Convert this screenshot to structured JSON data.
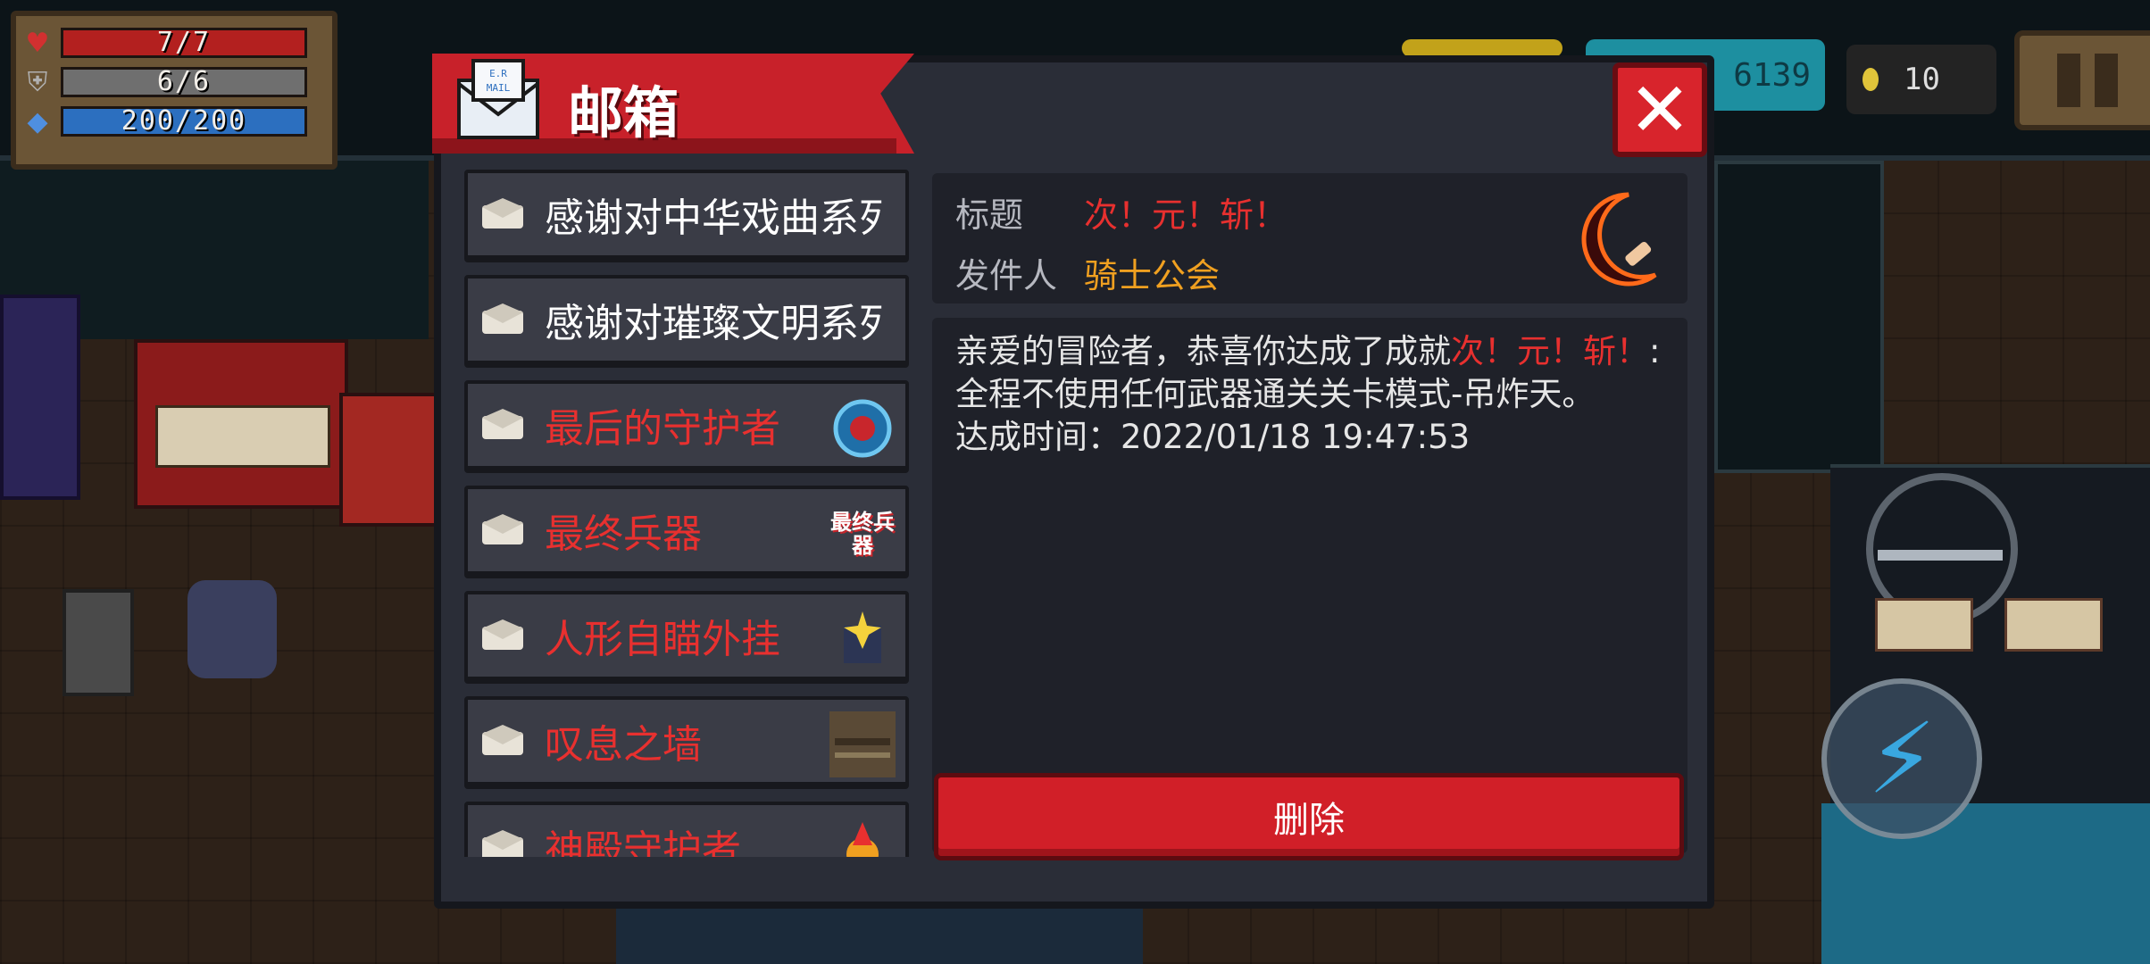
{
  "hud": {
    "hp": "7/7",
    "armor": "6/6",
    "energy": "200/200",
    "gems": "6139",
    "coins": "10"
  },
  "mailbox": {
    "title": "邮箱",
    "mail_icon_text": "E.R MAIL",
    "close_label": "✕",
    "items": [
      {
        "title": "感谢对中华戏曲系列",
        "read": true,
        "color": "#ffffff"
      },
      {
        "title": "感谢对璀璨文明系列",
        "read": true,
        "color": "#ffffff"
      },
      {
        "title": "最后的守护者",
        "read": true,
        "color": "#e8302f"
      },
      {
        "title": "最终兵器",
        "read": true,
        "color": "#e8302f",
        "thumb_text": "最终兵器"
      },
      {
        "title": "人形自瞄外挂",
        "read": true,
        "color": "#e8302f"
      },
      {
        "title": "叹息之墙",
        "read": true,
        "color": "#e8302f"
      },
      {
        "title": "神殿守护者",
        "read": true,
        "color": "#e8302f"
      }
    ],
    "detail": {
      "title_label": "标题",
      "title_value": "次！元！斩！",
      "sender_label": "发件人",
      "sender_value": "骑士公会",
      "body_prefix": "亲爱的冒险者，恭喜你达成了成就",
      "body_highlight": "次！元！斩！",
      "body_suffix": ":全程不使用任何武器通关关卡模式-吊炸天。",
      "time_label": "达成时间：",
      "time_value": "2022/01/18 19:47:53"
    },
    "delete_label": "删除"
  },
  "colors": {
    "accent_red": "#d11f28",
    "highlight_red": "#e8302f",
    "sender_orange": "#f0a020",
    "label_grey": "#b6b8c0"
  }
}
